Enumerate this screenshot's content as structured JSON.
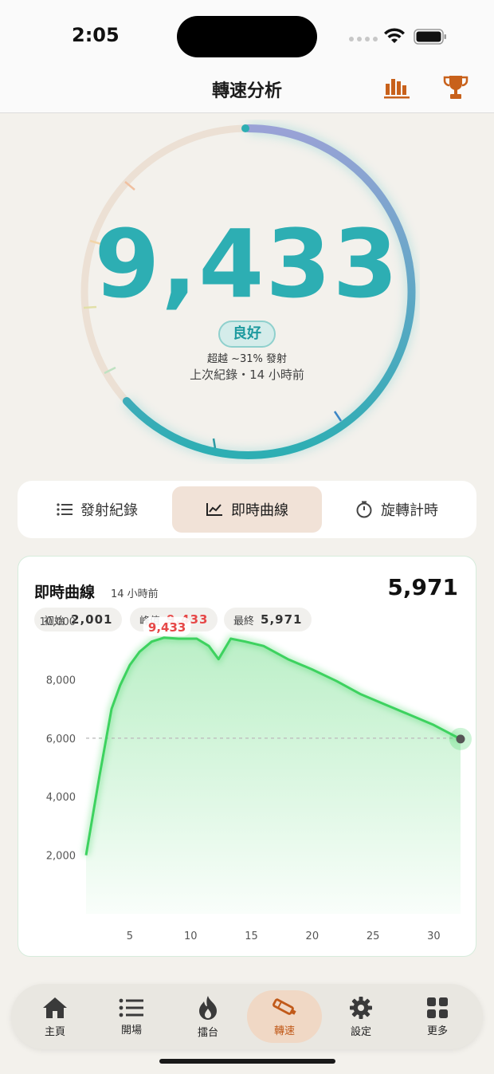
{
  "status": {
    "time": "2:05"
  },
  "header": {
    "title": "轉速分析",
    "icons": [
      "bar-chart-icon",
      "trophy-icon"
    ]
  },
  "colors": {
    "accent": "#2daeb3",
    "brand": "#c15a1a",
    "line": "#3dd25f",
    "peak": "#e64848"
  },
  "gauge": {
    "value": "9,433",
    "rating": "良好",
    "beat_text": "超越 ~31% 發射",
    "last_record": "上次紀錄・14 小時前"
  },
  "segments": [
    {
      "label": "發射紀錄",
      "icon": "list-icon"
    },
    {
      "label": "即時曲線",
      "icon": "line-chart-icon",
      "active": true
    },
    {
      "label": "旋轉計時",
      "icon": "timer-icon"
    }
  ],
  "chart_card": {
    "title": "即時曲線",
    "subtitle": "14 小時前",
    "final_value": "5,971",
    "chips": [
      {
        "label": "初始",
        "value": "2,001"
      },
      {
        "label": "峰值",
        "value": "9,433"
      },
      {
        "label": "最終",
        "value": "5,971"
      }
    ]
  },
  "chart_data": {
    "type": "area",
    "title": "",
    "xlabel": "",
    "ylabel": "",
    "xlim": [
      1.4,
      32.2
    ],
    "ylim": [
      0,
      10000
    ],
    "x_ticks": [
      5,
      10,
      15,
      20,
      25,
      30
    ],
    "y_ticks": [
      2000,
      4000,
      6000,
      8000,
      10000
    ],
    "y_tick_labels": [
      "2,000",
      "4,000",
      "6,000",
      "8,000",
      "10,000"
    ],
    "x_tick_labels": [
      "5",
      "10",
      "15",
      "20",
      "25",
      "30"
    ],
    "reference_line": 6000,
    "peak_label": "9,433",
    "series": [
      {
        "x": [
          1.4,
          2.5,
          3.5,
          4.2,
          5.0,
          5.8,
          6.8,
          7.8,
          9.0,
          10.5,
          11.5,
          12.3,
          13.3,
          14.5,
          16,
          18,
          20,
          22,
          24,
          26,
          28,
          30,
          32.2
        ],
        "y": [
          2001,
          4700,
          7000,
          7800,
          8500,
          8950,
          9300,
          9433,
          9400,
          9400,
          9150,
          8700,
          9400,
          9300,
          9150,
          8700,
          8350,
          7950,
          7500,
          7150,
          6800,
          6450,
          5971
        ]
      }
    ]
  },
  "tabs": [
    {
      "label": "主頁",
      "icon": "home-icon"
    },
    {
      "label": "開場",
      "icon": "list-icon"
    },
    {
      "label": "擂台",
      "icon": "flame-icon"
    },
    {
      "label": "轉速",
      "icon": "launcher-icon",
      "active": true
    },
    {
      "label": "設定",
      "icon": "gear-icon"
    },
    {
      "label": "更多",
      "icon": "grid-icon"
    }
  ]
}
